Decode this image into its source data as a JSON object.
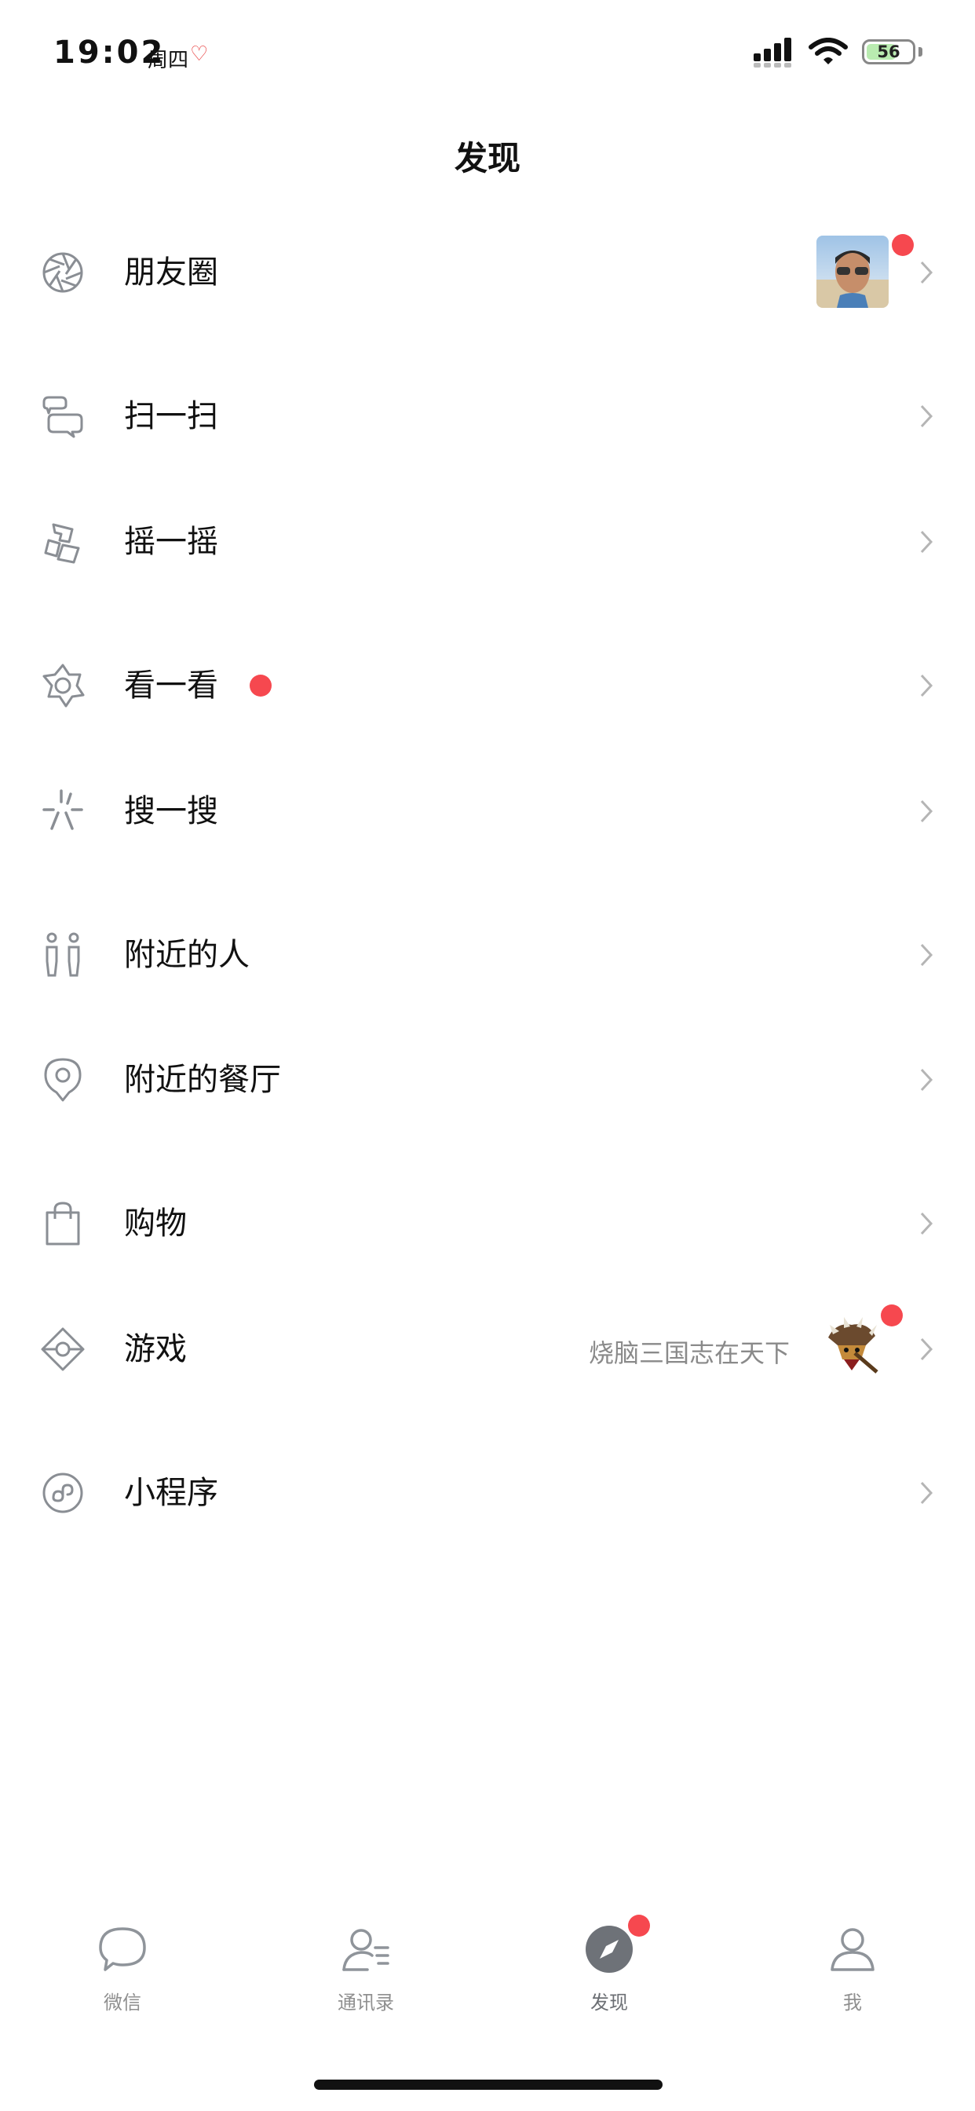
{
  "status_bar": {
    "time": "19:02",
    "day": "周四",
    "heart": "♡",
    "battery": "56"
  },
  "header": {
    "title": "发现"
  },
  "items": [
    {
      "label": "朋友圈",
      "icon": "moments-aperture-icon",
      "has_avatar": true,
      "badge": true
    },
    {
      "label": "扫一扫",
      "icon": "scan-icon"
    },
    {
      "label": "摇一摇",
      "icon": "shake-icon"
    },
    {
      "label": "看一看",
      "icon": "top-stories-icon",
      "badge": true
    },
    {
      "label": "搜一搜",
      "icon": "search-sparkle-icon"
    },
    {
      "label": "附近的人",
      "icon": "people-nearby-icon"
    },
    {
      "label": "附近的餐厅",
      "icon": "location-pin-icon"
    },
    {
      "label": "购物",
      "icon": "shopping-bag-icon"
    },
    {
      "label": "游戏",
      "icon": "game-icon",
      "extra": "烧脑三国志在天下",
      "badge": true
    },
    {
      "label": "小程序",
      "icon": "mini-program-icon"
    }
  ],
  "tab_bar": {
    "tabs": [
      {
        "label": "微信",
        "icon": "chat-bubble-icon"
      },
      {
        "label": "通讯录",
        "icon": "contacts-icon"
      },
      {
        "label": "发现",
        "icon": "compass-icon",
        "active": true,
        "badge": true
      },
      {
        "label": "我",
        "icon": "me-person-icon"
      }
    ]
  },
  "colors": {
    "badge": "#f6484f",
    "icon_gray": "#8a8e94",
    "label_gray": "#8a8a8a"
  }
}
